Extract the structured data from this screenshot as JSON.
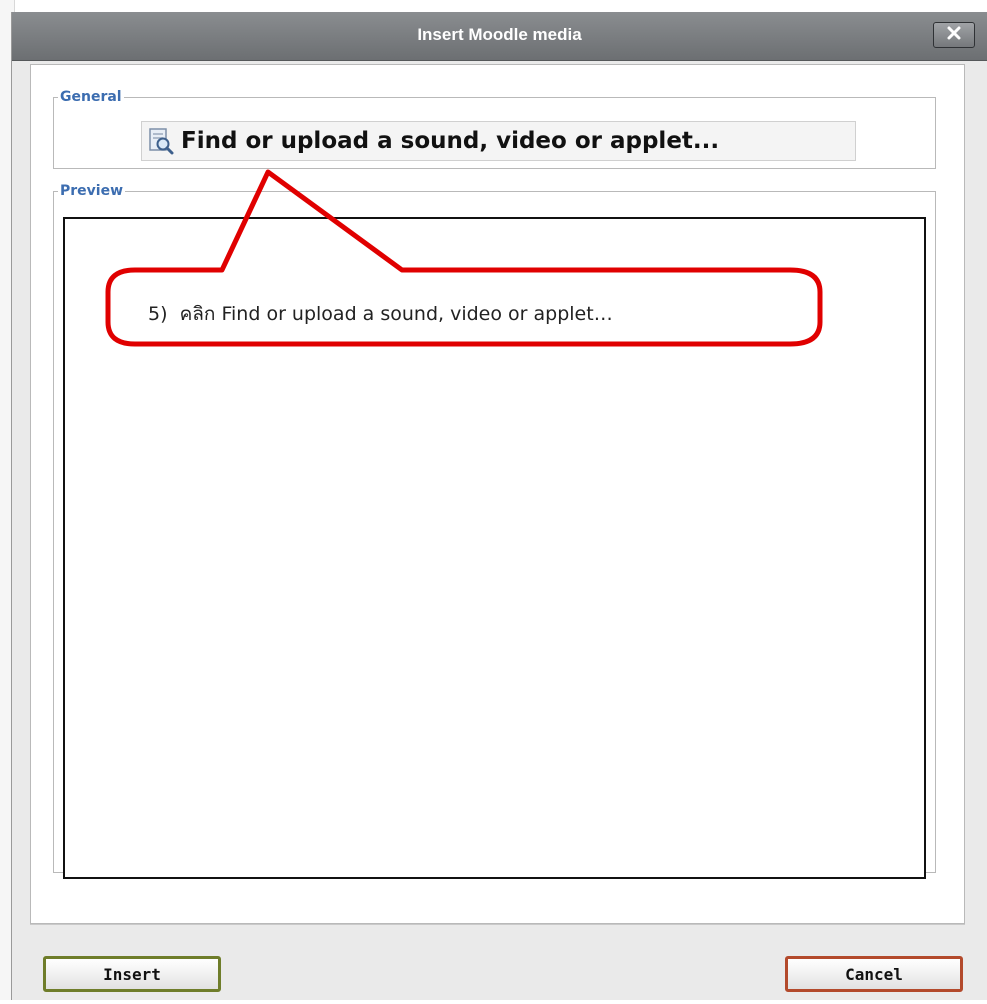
{
  "dialog": {
    "title": "Insert Moodle media",
    "close_icon": "close-icon"
  },
  "general": {
    "legend": "General",
    "find_link_label": "Find or upload a sound, video or applet...",
    "find_link_icon": "file-search-icon"
  },
  "preview": {
    "legend": "Preview"
  },
  "buttons": {
    "insert": "Insert",
    "cancel": "Cancel"
  },
  "annotation": {
    "text": "5)  คลิก Find or upload a sound, video or applet…",
    "color": "#e00000"
  },
  "colors": {
    "titlebar": "#7a7d80",
    "legend": "#3c6db0",
    "insert_border": "#6f7d2a",
    "cancel_border": "#b34a2c"
  }
}
